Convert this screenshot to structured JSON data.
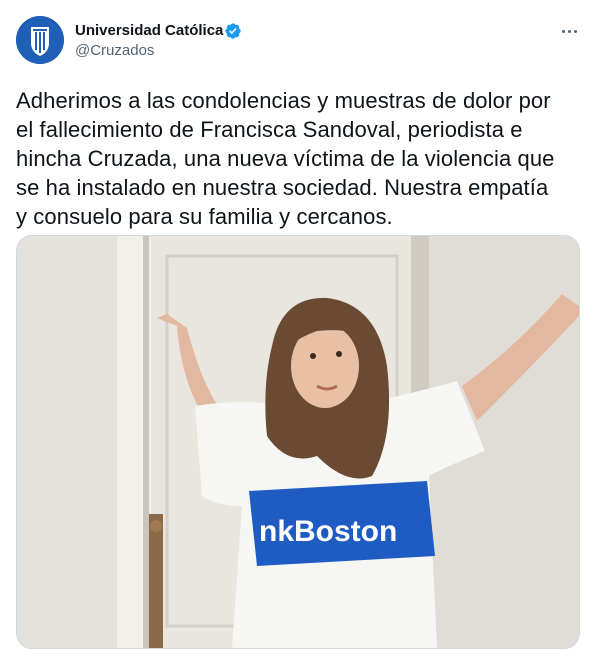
{
  "author": {
    "name": "Universidad Católica",
    "handle": "@Cruzados",
    "verified": true
  },
  "tweet": {
    "lines": [
      "Adherimos a las condolencias y muestras de dolor por",
      "el fallecimiento de Francisca Sandoval, periodista e",
      "hincha Cruzada, una nueva víctima de la violencia que",
      "se ha instalado en nuestra sociedad. Nuestra empatía",
      "y consuelo para su familia y cercanos."
    ]
  },
  "photo": {
    "shirt_text": "nkBoston"
  },
  "icons": {
    "avatar": "university-crest-icon",
    "verified": "verified-badge-icon",
    "more": "more-options-icon"
  },
  "colors": {
    "brand_blue": "#1f5fb8",
    "verified_blue": "#1d9bf0",
    "handle_gray": "#536471",
    "text": "#0f1419"
  }
}
